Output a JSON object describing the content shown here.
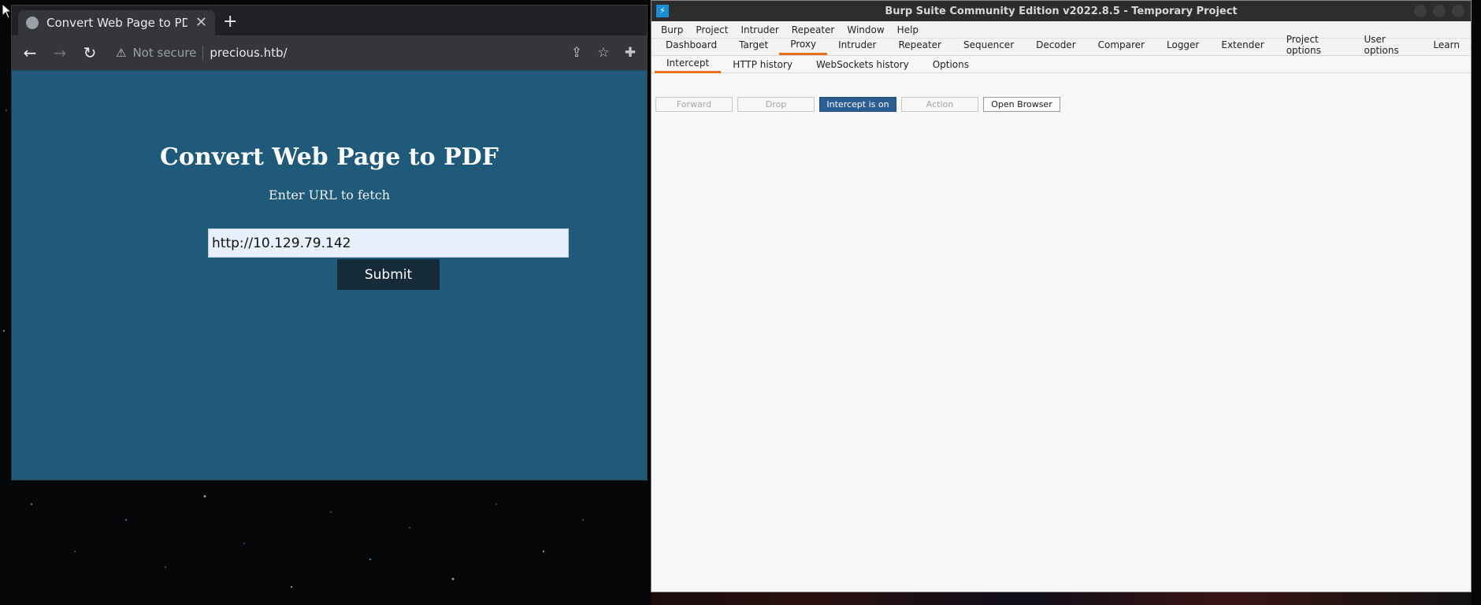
{
  "browser": {
    "tab": {
      "title": "Convert Web Page to PDF",
      "favicon": "globe-icon",
      "close_glyph": "✕"
    },
    "newtab_glyph": "+",
    "address": {
      "security_label": "Not secure",
      "url": "precious.htb/"
    },
    "page": {
      "heading": "Convert Web Page to PDF",
      "subtitle": "Enter URL to fetch",
      "url_value": "http://10.129.79.142",
      "submit_label": "Submit",
      "background": "#1f5a7a"
    }
  },
  "burp": {
    "title": "Burp Suite Community Edition v2022.8.5 - Temporary Project",
    "menu": [
      "Burp",
      "Project",
      "Intruder",
      "Repeater",
      "Window",
      "Help"
    ],
    "tabs": [
      "Dashboard",
      "Target",
      "Proxy",
      "Intruder",
      "Repeater",
      "Sequencer",
      "Decoder",
      "Comparer",
      "Logger",
      "Extender",
      "Project options",
      "User options",
      "Learn"
    ],
    "active_tab": "Proxy",
    "subtabs": [
      "Intercept",
      "HTTP history",
      "WebSockets history",
      "Options"
    ],
    "active_subtab": "Intercept",
    "buttons": {
      "forward": "Forward",
      "drop": "Drop",
      "intercept": "Intercept is on",
      "action": "Action",
      "open_browser": "Open Browser"
    },
    "accent": "#e8701a",
    "intercept_color": "#2c5e93"
  }
}
